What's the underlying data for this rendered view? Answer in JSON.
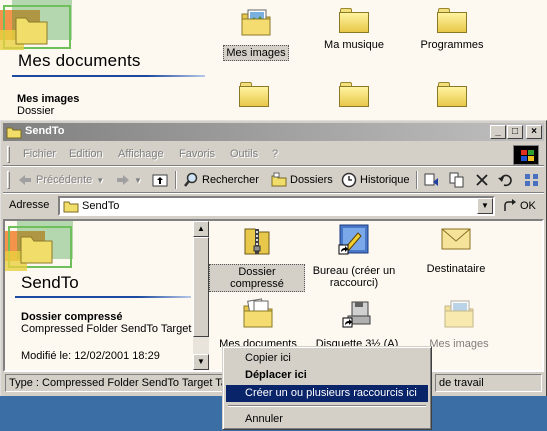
{
  "back_window": {
    "title": "Mes documents",
    "selected_name": "Mes images",
    "selected_type": "Dossier",
    "icons": [
      {
        "label": "Mes images",
        "kind": "folder-images-icon"
      },
      {
        "label": "Ma musique",
        "kind": "folder-icon"
      },
      {
        "label": "Programmes",
        "kind": "folder-icon"
      }
    ]
  },
  "window": {
    "title": "SendTo",
    "controls": {
      "minimize": "_",
      "maximize": "□",
      "close": "×"
    },
    "menu": [
      "Fichier",
      "Edition",
      "Affichage",
      "Favoris",
      "Outils",
      "?"
    ],
    "toolbar": {
      "back": "Précédente",
      "search": "Rechercher",
      "folders": "Dossiers",
      "history": "Historique"
    },
    "address": {
      "label": "Adresse",
      "value": "SendTo",
      "go": "OK"
    },
    "left_panel": {
      "title": "SendTo",
      "selected_name": "Dossier compressé",
      "selected_desc": "Compressed Folder SendTo Target",
      "modified": "Modifié le: 12/02/2001 18:29"
    },
    "icons": [
      {
        "label": "Dossier compressé",
        "kind": "zip-folder-icon"
      },
      {
        "label": "Bureau (créer un raccourci)",
        "kind": "desktop-shortcut-icon"
      },
      {
        "label": "Destinataire",
        "kind": "mail-icon"
      },
      {
        "label": "Mes documents",
        "kind": "folder-docs-icon"
      },
      {
        "label": "Disquette 3½ (A)",
        "kind": "floppy-icon"
      },
      {
        "label": "Mes images",
        "kind": "folder-images-icon"
      }
    ],
    "status": {
      "left": "Type : Compressed Folder SendTo Target Ta",
      "right": "de travail"
    }
  },
  "context_menu": {
    "items": [
      "Copier ici",
      "Déplacer ici",
      "Créer un ou plusieurs raccourcis ici",
      "Annuler"
    ]
  },
  "colors": {
    "highlight": "#0a246a",
    "face": "#d4d0c8",
    "desktop": "#3a6ea5"
  }
}
